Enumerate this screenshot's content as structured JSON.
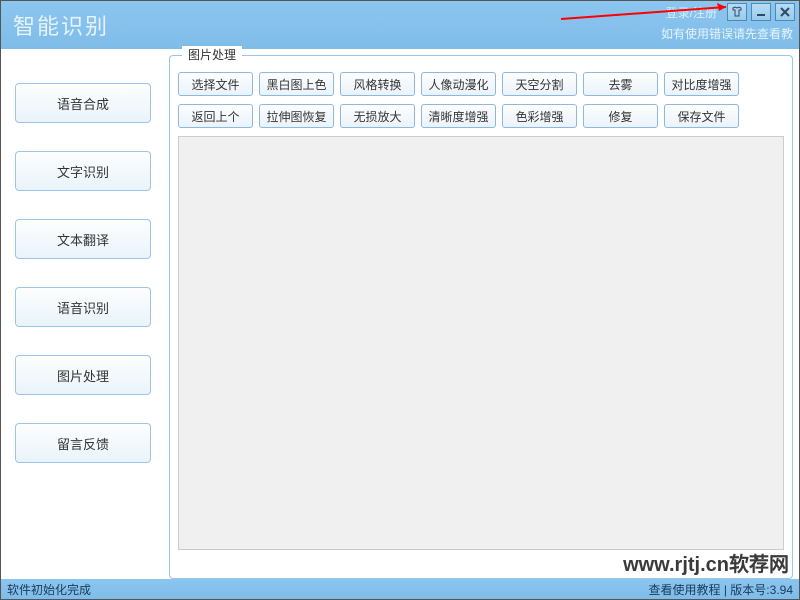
{
  "titlebar": {
    "app_title": "智能识别",
    "login_text": "登录/注册",
    "help_text": "如有使用错误请先查看教"
  },
  "sidebar": {
    "items": [
      {
        "label": "语音合成"
      },
      {
        "label": "文字识别"
      },
      {
        "label": "文本翻译"
      },
      {
        "label": "语音识别"
      },
      {
        "label": "图片处理"
      },
      {
        "label": "留言反馈"
      }
    ]
  },
  "content": {
    "group_title": "图片处理",
    "toolbar_row1": [
      {
        "label": "选择文件"
      },
      {
        "label": "黑白图上色"
      },
      {
        "label": "风格转换"
      },
      {
        "label": "人像动漫化"
      },
      {
        "label": "天空分割"
      },
      {
        "label": "去雾"
      },
      {
        "label": "对比度增强"
      }
    ],
    "toolbar_row2": [
      {
        "label": "返回上个"
      },
      {
        "label": "拉伸图恢复"
      },
      {
        "label": "无损放大"
      },
      {
        "label": "清晰度增强"
      },
      {
        "label": "色彩增强"
      },
      {
        "label": "修复"
      },
      {
        "label": "保存文件"
      }
    ]
  },
  "statusbar": {
    "left": "软件初始化完成",
    "right_tutorial": "查看使用教程",
    "right_version_label": "版本号:",
    "right_version_value": "3.94"
  },
  "watermark": "www.rjtj.cn软荐网"
}
